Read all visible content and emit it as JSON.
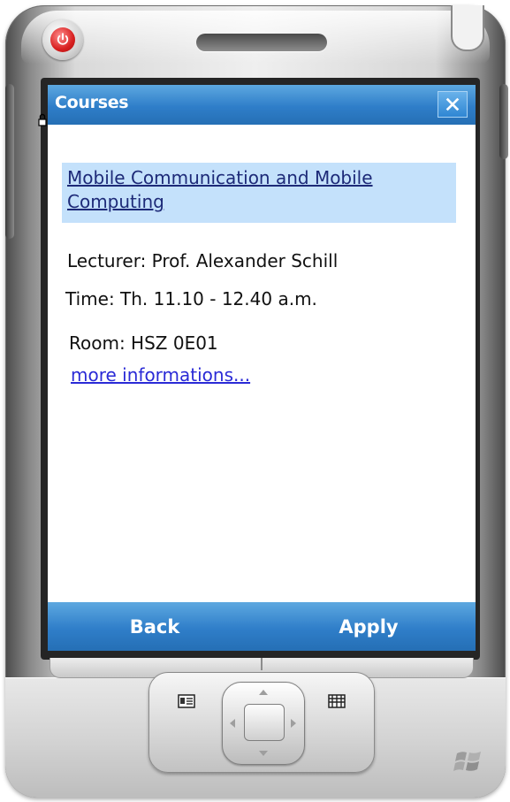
{
  "window": {
    "title": "Courses",
    "close_icon": "close-icon"
  },
  "course": {
    "name": "Mobile Communication and Mobile Computing",
    "lecturer": "Lecturer: Prof. Alexander Schill",
    "time": "Time: Th. 11.10 - 12.40 a.m.",
    "room": "Room: HSZ 0E01",
    "more_link": "more informations..."
  },
  "softkeys": {
    "left_label": "Back",
    "right_label": "Apply"
  },
  "colors": {
    "accent_blue": "#2f7ec9",
    "highlight": "#c4e1fb",
    "link": "#2a2ad6",
    "power_red": "#d82020"
  },
  "icons": {
    "power": "power-icon",
    "lock": "lock-icon",
    "left_key": "contacts-icon",
    "right_key": "calendar-icon",
    "dpad": "dpad-icon",
    "brand": "windows-logo-icon"
  }
}
